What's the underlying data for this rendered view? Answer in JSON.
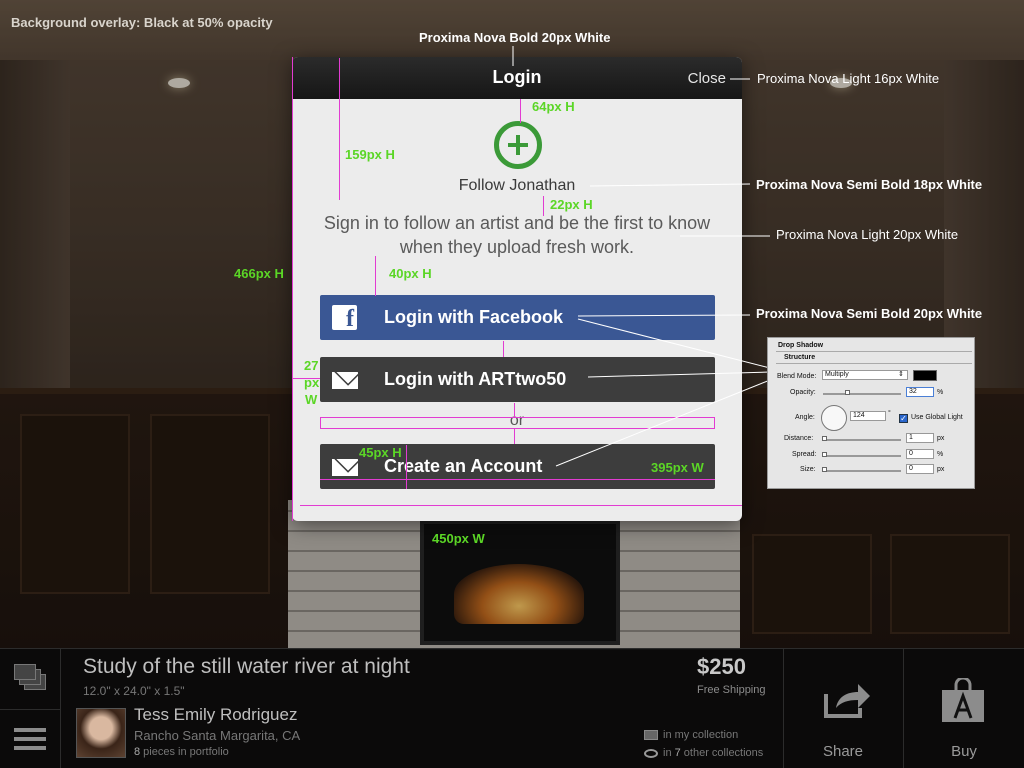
{
  "annotations": {
    "overlay_note": "Background overlay: Black at 50% opacity",
    "title_spec": "Proxima Nova Bold 20px White",
    "close_spec": "Proxima Nova Light 16px White",
    "follow_spec": "Proxima Nova Semi Bold 18px White",
    "subtitle_spec": "Proxima Nova Light 20px White",
    "button_spec": "Proxima Nova Semi Bold 20px White",
    "measurements": {
      "icon_height": "64px H",
      "header_to_title": "159px H",
      "title_gap": "22px H",
      "text_to_button": "40px H",
      "modal_height": "466px H",
      "inset_width_a": "27",
      "inset_width_b": "px",
      "inset_width_c": "W",
      "button_height": "45px H",
      "button_width": "395px W",
      "modal_width": "450px W"
    }
  },
  "modal": {
    "title": "Login",
    "close_label": "Close",
    "icon": "plus-circle-icon",
    "follow_heading": "Follow Jonathan",
    "subtitle": "Sign in to follow an artist and be the first to know when they upload fresh work.",
    "facebook_button": "Login with Facebook",
    "artwo50_button": "Login with ARTtwo50",
    "or_label": "or",
    "create_button": "Create an Account",
    "colors": {
      "facebook": "#3a5794",
      "dark_button": "#3d3d3d",
      "plus_green": "#3b9a38"
    }
  },
  "ps_panel": {
    "title": "Drop Shadow",
    "section": "Structure",
    "blend_mode_label": "Blend Mode:",
    "blend_mode_value": "Multiply",
    "opacity_label": "Opacity:",
    "opacity_value": "32",
    "opacity_unit": "%",
    "angle_label": "Angle:",
    "angle_value": "124",
    "angle_unit": "°",
    "global_light_label": "Use Global Light",
    "distance_label": "Distance:",
    "distance_value": "1",
    "distance_unit": "px",
    "spread_label": "Spread:",
    "spread_value": "0",
    "spread_unit": "%",
    "size_label": "Size:",
    "size_value": "0",
    "size_unit": "px"
  },
  "artwork": {
    "title": "Study of the still water river at night",
    "dimensions": "12.0\" x 24.0\" x 1.5\"",
    "artist_name": "Tess Emily Rodriguez",
    "artist_location": "Rancho Santa Margarita, CA",
    "portfolio_count": "8",
    "portfolio_suffix": " pieces in portfolio",
    "price": "$250",
    "shipping": "Free Shipping",
    "in_collection": "in my collection",
    "other_prefix": "in ",
    "other_count": "7",
    "other_suffix": " other collections"
  },
  "actions": {
    "share_label": "Share",
    "buy_label": "Buy"
  }
}
